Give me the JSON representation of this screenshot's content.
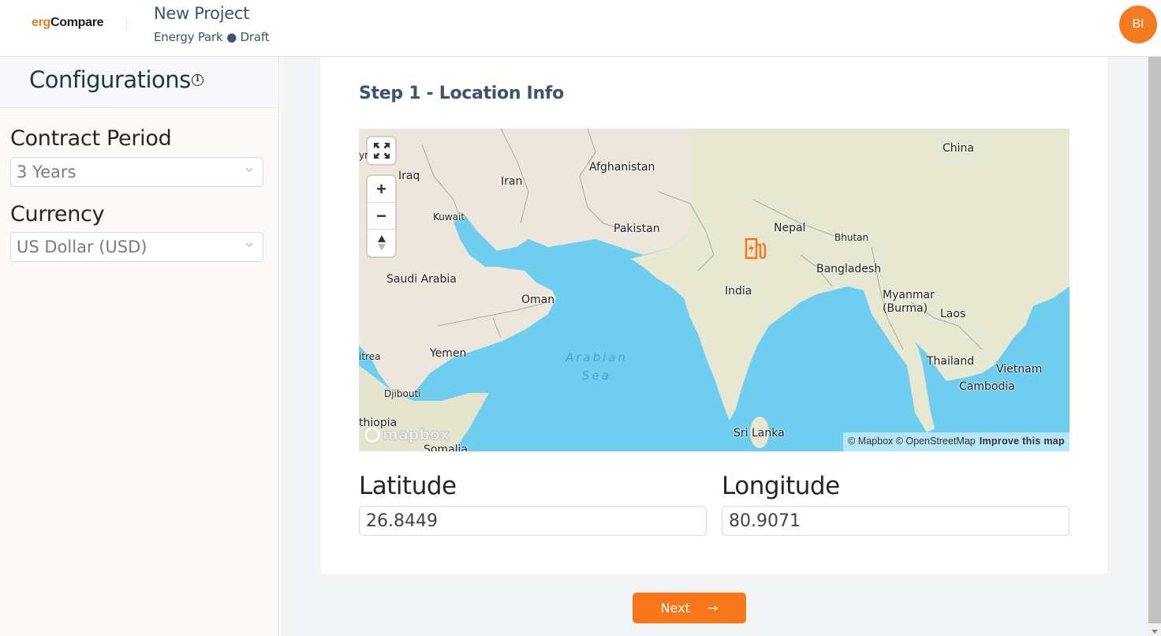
{
  "header": {
    "logo_prefix": "erg",
    "logo_suffix": "Compare",
    "project_title": "New Project",
    "project_subtitle": "Energy Park ● Draft",
    "avatar_initials": "BI"
  },
  "sidebar": {
    "title": "Configurations",
    "info_icon": "i",
    "fields": [
      {
        "label": "Contract Period",
        "value": "3 Years"
      },
      {
        "label": "Currency",
        "value": "US Dollar (USD)"
      }
    ]
  },
  "main": {
    "step_title": "Step 1 - Location Info",
    "map": {
      "controls": {
        "fullscreen": "fullscreen-icon",
        "zoom_in": "+",
        "zoom_out": "−",
        "compass": "compass-icon"
      },
      "marker": "ev-charging-station-icon",
      "labels": {
        "syria_partial": "yr",
        "iraq": "Iraq",
        "iran": "Iran",
        "afghanistan": "Afghanistan",
        "china": "China",
        "kuwait": "Kuwait",
        "pakistan": "Pakistan",
        "nepal": "Nepal",
        "bhutan": "Bhutan",
        "saudi_arabia": "Saudi Arabia",
        "bangladesh": "Bangladesh",
        "oman": "Oman",
        "india": "India",
        "myanmar": "Myanmar\n(Burma)",
        "laos": "Laos",
        "eritrea_partial": "itrea",
        "yemen": "Yemen",
        "arabian_sea": "Arabian\nSea",
        "thailand": "Thailand",
        "vietnam": "Vietnam",
        "djibouti": "Djibouti",
        "cambodia": "Cambodia",
        "ethiopia_partial": "thiopia",
        "sri_lanka": "Sri Lanka",
        "somalia_partial": "Somalia"
      },
      "logo": "mapbox",
      "attribution": "© Mapbox © OpenStreetMap",
      "improve_link": "Improve this map"
    },
    "latitude": {
      "label": "Latitude",
      "value": "26.8449"
    },
    "longitude": {
      "label": "Longitude",
      "value": "80.9071"
    },
    "next_button": {
      "label": "Next",
      "icon": "→"
    }
  },
  "colors": {
    "accent": "#f7761a",
    "heading": "#3c5372",
    "water": "#6fcdf0",
    "land": "#ede6dc"
  }
}
